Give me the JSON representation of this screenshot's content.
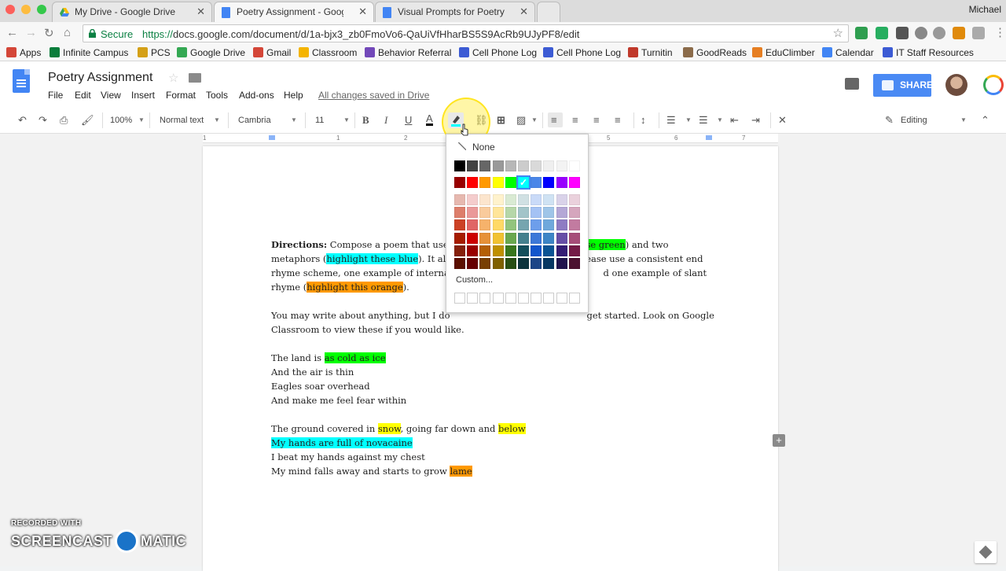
{
  "browser": {
    "tabs": [
      {
        "title": "My Drive - Google Drive",
        "icon": "google-drive-icon",
        "active": false
      },
      {
        "title": "Poetry Assignment - Google Docs",
        "icon": "google-docs-icon",
        "active": true
      },
      {
        "title": "Visual Prompts for Poetry Assignment",
        "icon": "google-docs-icon",
        "active": false
      }
    ],
    "profile_name": "Michael",
    "secure_label": "Secure",
    "url_protocol": "https://",
    "url_rest": "docs.google.com/document/d/1a-bjx3_zb0FmoVo6-QaUiVfHharBS5S9AcRb9UJyPF8/edit",
    "bookmarks": [
      {
        "label": "Apps",
        "color": "#d44638"
      },
      {
        "label": "Infinite Campus",
        "color": "#0a7d3b"
      },
      {
        "label": "PCS",
        "color": "#d4a017"
      },
      {
        "label": "Google Drive",
        "color": "#34a853"
      },
      {
        "label": "Gmail",
        "color": "#d44638"
      },
      {
        "label": "Classroom",
        "color": "#f4b400"
      },
      {
        "label": "Behavior Referral",
        "color": "#7248b9"
      },
      {
        "label": "Cell Phone Log",
        "color": "#3c5bd4"
      },
      {
        "label": "Cell Phone Log",
        "color": "#3c5bd4"
      },
      {
        "label": "Turnitin",
        "color": "#c0392b"
      },
      {
        "label": "GoodReads",
        "color": "#8b6b4a"
      },
      {
        "label": "EduClimber",
        "color": "#e67e22"
      },
      {
        "label": "Calendar",
        "color": "#4285f4"
      },
      {
        "label": "IT Staff Resources",
        "color": "#3c5bd4"
      }
    ]
  },
  "docs": {
    "title": "Poetry Assignment",
    "menus": [
      "File",
      "Edit",
      "View",
      "Insert",
      "Format",
      "Tools",
      "Add-ons",
      "Help"
    ],
    "saved_status": "All changes saved in Drive",
    "share_label": "SHARE",
    "toolbar": {
      "zoom": "100%",
      "style": "Normal text",
      "font": "Cambria",
      "size": "11",
      "mode": "Editing"
    },
    "ruler_numbers": [
      "1",
      "1",
      "2",
      "3",
      "4",
      "5",
      "6",
      "7"
    ]
  },
  "document": {
    "directions_label": "Directions:",
    "line1_a": " Compose a poem that uses",
    "line1_hl": "se green",
    "line1_b": ") and two",
    "line2_a": "metaphors (",
    "line2_hl": "highlight these blue",
    "line2_b": "). It als",
    "line2_c": "ease use a consistent end",
    "line3_a": "rhyme scheme, one example of internal",
    "line3_b": "d one example of slant",
    "line4_a": "rhyme (",
    "line4_hl": "highlight this orange",
    "line4_b": ").",
    "para2_a": "You may write about anything, but I do",
    "para2_b": "get started. Look on Google",
    "para2_line2": "Classroom to view these if you would like.",
    "stanza1": {
      "l1_a": "The land is ",
      "l1_hl": "as cold as ice",
      "l2": "And the air is thin",
      "l3": "Eagles soar overhead",
      "l4": "And make me feel fear within"
    },
    "stanza2": {
      "l1_a": "The ground covered in ",
      "l1_hl1": "snow",
      "l1_b": ", going far down and ",
      "l1_hl2": "below",
      "l2_hl": "My hands are full of novacaine",
      "l3": "I beat my hands against my chest",
      "l4_a": "My mind falls away and starts to grow ",
      "l4_hl": "lame"
    }
  },
  "palette": {
    "none_label": "None",
    "custom_label": "Custom...",
    "selected_checkmark": "✓",
    "grays": [
      "#000000",
      "#434343",
      "#666666",
      "#999999",
      "#b7b7b7",
      "#cccccc",
      "#d9d9d9",
      "#efefef",
      "#f3f3f3",
      "#ffffff"
    ],
    "bright": [
      "#980000",
      "#ff0000",
      "#ff9900",
      "#ffff00",
      "#00ff00",
      "#00ffff",
      "#4a86e8",
      "#0000ff",
      "#9900ff",
      "#ff00ff"
    ],
    "tints": [
      [
        "#e6b8af",
        "#f4cccc",
        "#fce5cd",
        "#fff2cc",
        "#d9ead3",
        "#d0e0e3",
        "#c9daf8",
        "#cfe2f3",
        "#d9d2e9",
        "#ead1dc"
      ],
      [
        "#dd7e6b",
        "#ea9999",
        "#f9cb9c",
        "#ffe599",
        "#b6d7a8",
        "#a2c4c9",
        "#a4c2f4",
        "#9fc5e8",
        "#b4a7d6",
        "#d5a6bd"
      ],
      [
        "#cc4125",
        "#e06666",
        "#f6b26b",
        "#ffd966",
        "#93c47d",
        "#76a5af",
        "#6d9eeb",
        "#6fa8dc",
        "#8e7cc3",
        "#c27ba0"
      ],
      [
        "#a61c00",
        "#cc0000",
        "#e69138",
        "#f1c232",
        "#6aa84f",
        "#45818e",
        "#3c78d8",
        "#3d85c6",
        "#674ea7",
        "#a64d79"
      ],
      [
        "#85200c",
        "#990000",
        "#b45f06",
        "#bf9000",
        "#38761d",
        "#134f5c",
        "#1155cc",
        "#0b5394",
        "#351c75",
        "#741b47"
      ],
      [
        "#5b0f00",
        "#660000",
        "#783f04",
        "#7f6000",
        "#274e13",
        "#0c343d",
        "#1c4587",
        "#073763",
        "#20124d",
        "#4c1130"
      ]
    ]
  },
  "watermark": {
    "top": "RECORDED WITH",
    "bottom_a": "SCREENCAST",
    "bottom_b": "MATIC"
  }
}
